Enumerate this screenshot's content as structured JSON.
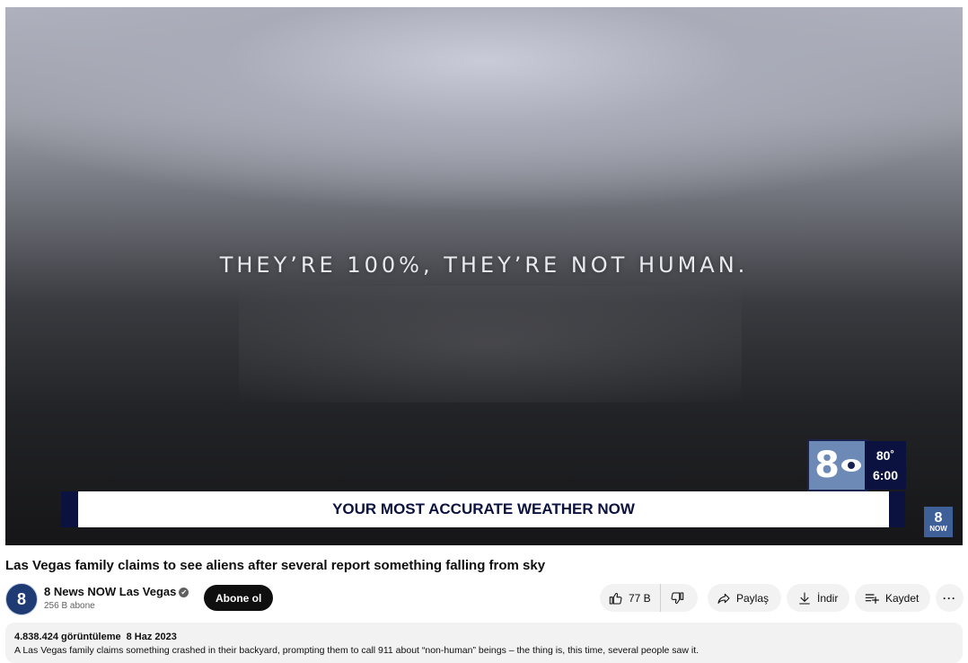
{
  "player": {
    "subtitle": "THEY’RE 100%, THEY’RE NOT HUMAN.",
    "logo_text": "8",
    "temperature": "80˚",
    "time": "6:00",
    "ticker_text": "YOUR MOST ACCURATE WEATHER NOW",
    "watermark_top": "8",
    "watermark_bottom": "NOW",
    "colors": {
      "ticker_navy": "#0b1240",
      "logo_blue": "#6d8ab6"
    }
  },
  "video": {
    "title": "Las Vegas family claims to see aliens after several report something falling from sky"
  },
  "channel": {
    "name": "8 News NOW Las Vegas",
    "verified_icon": "✔",
    "subscribers": "256 B abone",
    "avatar_text": "8",
    "subscribe_label": "Abone ol"
  },
  "actions": {
    "like_icon": "thumb-up-icon",
    "like_count": "77 B",
    "dislike_icon": "thumb-down-icon",
    "share_label": "Paylaş",
    "download_label": "İndir",
    "save_label": "Kaydet",
    "more_label": "···"
  },
  "description": {
    "views": "4.838.424 görüntüleme",
    "date": "8 Haz 2023",
    "text": "A Las Vegas family claims something crashed in their backyard, prompting them to call 911 about “non-human” beings – the thing is, this time, several people saw it."
  }
}
